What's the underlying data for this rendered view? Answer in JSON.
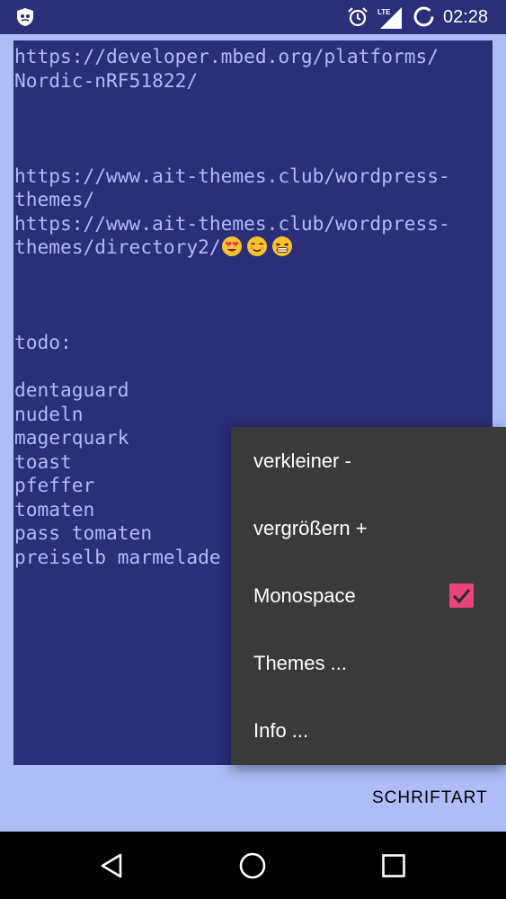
{
  "status_bar": {
    "time": "02:28",
    "network_label": "LTE",
    "icons": [
      "app-shield-icon",
      "alarm-icon",
      "lte-signal-icon",
      "sync-icon"
    ]
  },
  "editor": {
    "lines": [
      "https://developer.mbed.org/platforms/",
      "Nordic-nRF51822/",
      "",
      "",
      "",
      "https://www.ait-themes.club/wordpress-",
      "themes/",
      "https://www.ait-themes.club/wordpress-",
      "themes/directory2/",
      "",
      "",
      "",
      "todo:",
      "",
      "dentaguard",
      "nudeln",
      "magerquark",
      "toast",
      "pfeffer",
      "tomaten",
      "pass tomaten",
      "preiselb marmelade"
    ],
    "emojis": [
      "heart-eyes-emoji",
      "smiling-emoji",
      "grinning-emoji"
    ]
  },
  "menu": {
    "items": [
      {
        "label": "verkleiner -"
      },
      {
        "label": "vergrößern +"
      },
      {
        "label": "Monospace",
        "checked": true
      },
      {
        "label": "Themes ..."
      },
      {
        "label": "Info ..."
      }
    ]
  },
  "footer": {
    "font_button_label": "SCHRIFTART"
  },
  "nav_bar": {
    "icons": [
      "back-icon",
      "home-icon",
      "recents-icon"
    ]
  },
  "colors": {
    "editor_background": "#2b2e78",
    "editor_text": "#aebcf8",
    "page_background": "#aebcf8",
    "menu_background": "#3a3a3a",
    "checkbox_accent": "#e8437a"
  }
}
